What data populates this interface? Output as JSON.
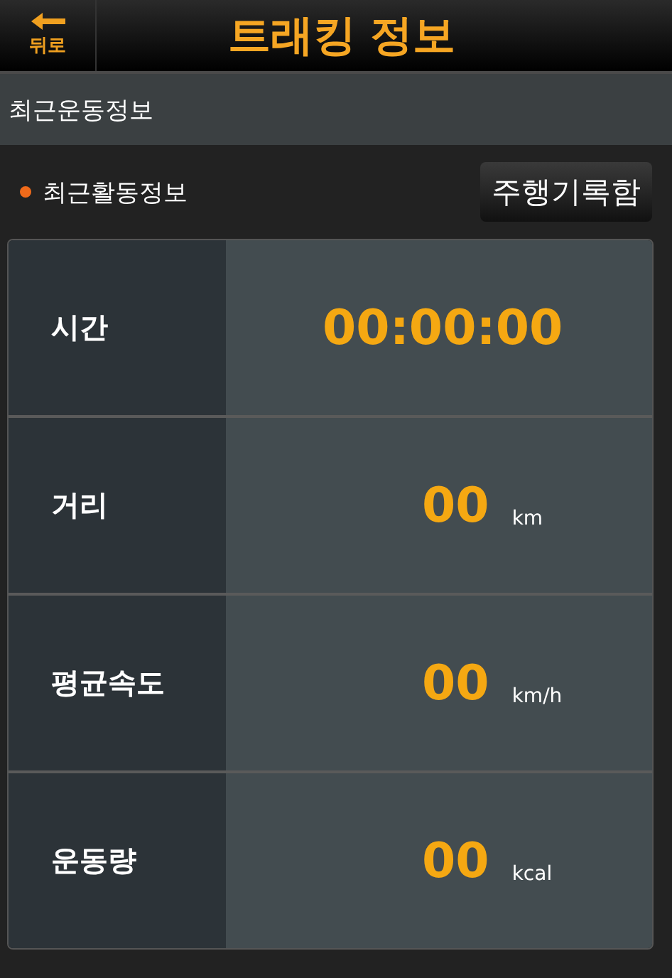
{
  "header": {
    "back_label": "뒤로",
    "title": "트래킹 정보"
  },
  "section_title": "최근운동정보",
  "activity": {
    "label": "최근활동정보",
    "button": "주행기록함"
  },
  "stats": [
    {
      "label": "시간",
      "value": "00:00:00"
    },
    {
      "label": "거리",
      "value": "00",
      "unit": "km"
    },
    {
      "label": "평균속도",
      "value": "00",
      "unit": "km/h"
    },
    {
      "label": "운동량",
      "value": "00",
      "unit": "kcal"
    }
  ]
}
